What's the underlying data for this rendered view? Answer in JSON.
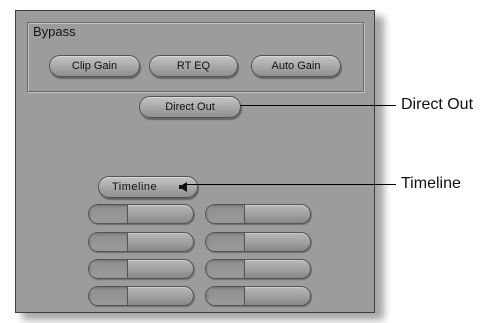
{
  "panel": {
    "bypass": {
      "label": "Bypass",
      "buttons": [
        {
          "label": "Clip Gain"
        },
        {
          "label": "RT EQ"
        },
        {
          "label": "Auto Gain"
        }
      ]
    },
    "direct_out_button": {
      "label": "Direct Out"
    },
    "timeline_button": {
      "label": "Timeline",
      "icon": "speaker-icon"
    }
  },
  "callouts": [
    {
      "label": "Direct Out"
    },
    {
      "label": "Timeline"
    }
  ]
}
